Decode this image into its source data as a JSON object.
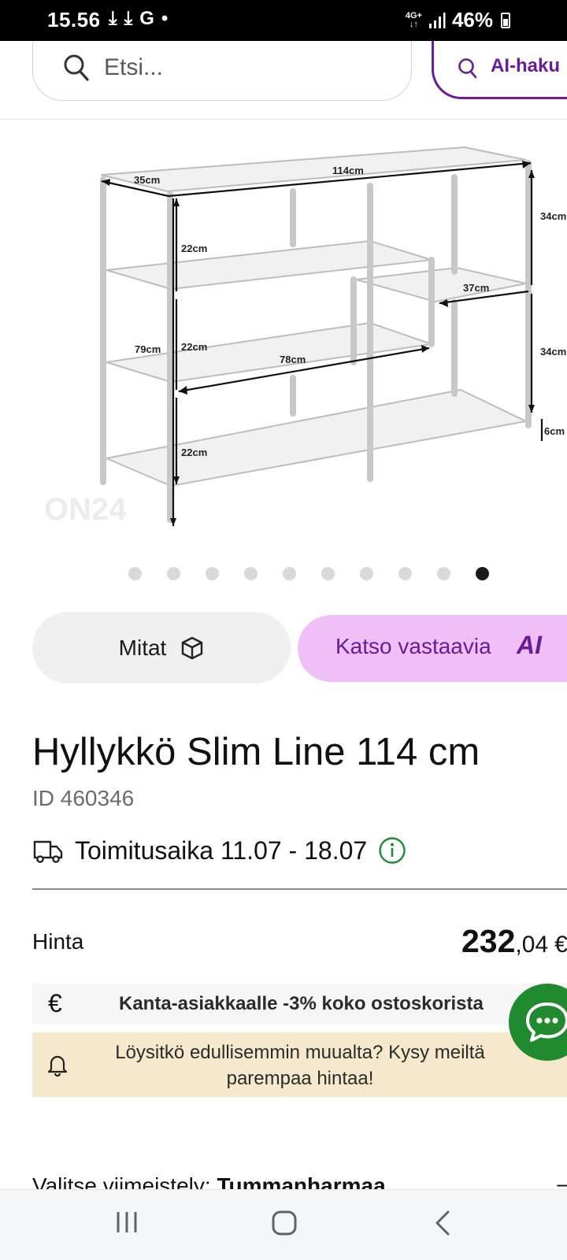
{
  "status_bar": {
    "time": "15.56",
    "left_icons": [
      "⤓",
      "⤓",
      "G",
      "•"
    ],
    "network_top": "4G+",
    "network_bottom": "↓↑",
    "battery": "46%"
  },
  "header": {
    "search_placeholder": "Etsi...",
    "ai_search_label": "AI-haku"
  },
  "gallery": {
    "image_count": 10,
    "active_index": 9,
    "watermark": "ON24",
    "dimensions": {
      "depth": "35cm",
      "width": "114cm",
      "right_upper_height": "34cm",
      "shelf_gap_1": "22cm",
      "shelf_gap_2": "22cm",
      "shelf_gap_3": "22cm",
      "small_shelf_width": "37cm",
      "total_height": "79cm",
      "middle_shelf_width": "78cm",
      "right_lower_height": "34cm",
      "foot_height": "6cm"
    }
  },
  "actions": {
    "dimensions_label": "Mitat",
    "similar_label": "Katso vastaavia",
    "similar_ai": "AI"
  },
  "product": {
    "title": "Hyllykkö Slim Line 114 cm",
    "id": "ID 460346",
    "delivery": "Toimitusaika 11.07 - 18.07"
  },
  "pricing": {
    "label": "Hinta",
    "price_main": "232",
    "price_decimals": ",04",
    "currency": "€",
    "loyalty_icon": "€",
    "loyalty_text": "Kanta-asiakkaalle -3% koko ostoskorista",
    "price_match_text": "Löysitkö edullisemmin muualta? Kysy meiltä parempaa hintaa!"
  },
  "finish": {
    "label": "Valitse viimeistely:",
    "value": "Tummanharmaa",
    "toggle": "−"
  },
  "colors": {
    "ai_purple": "#6a1b9a",
    "ai_button_bg": "#efc0f5",
    "chat_green": "#1f8a2e",
    "info_green": "#1f8a2e",
    "price_match_bg": "#f5e8cc"
  }
}
